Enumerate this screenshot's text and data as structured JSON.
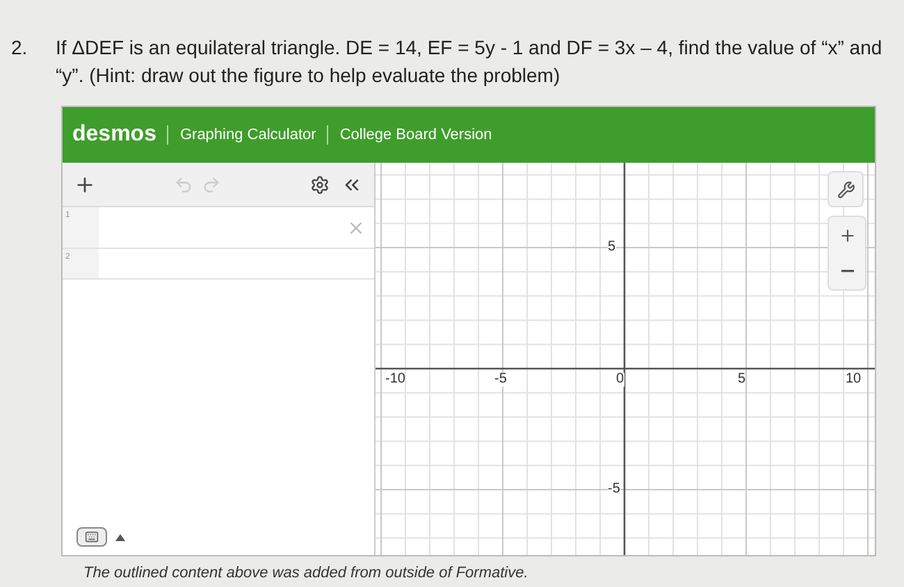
{
  "question": {
    "number": "2.",
    "text": "If ΔDEF is an equilateral triangle. DE = 14, EF = 5y - 1 and DF = 3x – 4, find the value of “x” and “y”. (Hint: draw out the figure to help evaluate the problem)"
  },
  "calculator": {
    "logo": "desmos",
    "title": "Graphing Calculator",
    "edition": "College Board Version",
    "expressions": [
      {
        "number": "1"
      },
      {
        "number": "2"
      }
    ],
    "graph": {
      "x_labels": [
        "-10",
        "-5",
        "0",
        "5",
        "10"
      ],
      "y_labels": [
        "5",
        "-5"
      ]
    }
  },
  "caption": "The outlined content above was added from outside of Formative."
}
